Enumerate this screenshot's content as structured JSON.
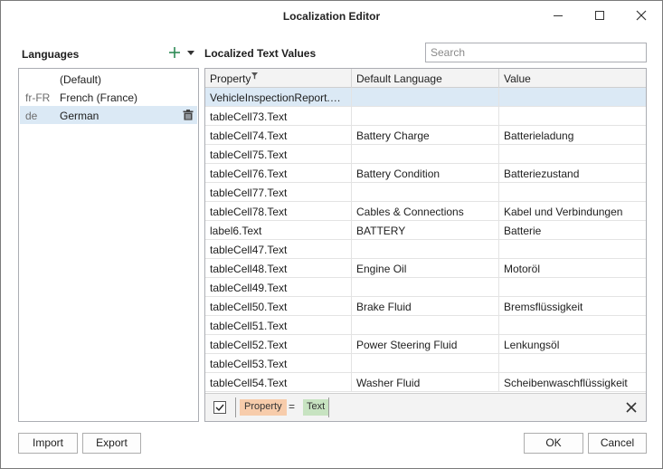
{
  "window": {
    "title": "Localization Editor"
  },
  "languages": {
    "header": "Languages",
    "items": [
      {
        "code": "",
        "name": "(Default)"
      },
      {
        "code": "fr-FR",
        "name": "French (France)"
      },
      {
        "code": "de",
        "name": "German"
      }
    ],
    "selected_index": 2
  },
  "localized": {
    "header": "Localized Text Values",
    "search_placeholder": "Search",
    "columns": [
      "Property",
      "Default Language",
      "Value"
    ],
    "rows": [
      {
        "property": "VehicleInspectionReport.W...",
        "default": "",
        "value": ""
      },
      {
        "property": "tableCell73.Text",
        "default": "",
        "value": ""
      },
      {
        "property": "tableCell74.Text",
        "default": "Battery Charge",
        "value": "Batterieladung"
      },
      {
        "property": "tableCell75.Text",
        "default": "",
        "value": ""
      },
      {
        "property": "tableCell76.Text",
        "default": "Battery Condition",
        "value": "Batteriezustand"
      },
      {
        "property": "tableCell77.Text",
        "default": "",
        "value": ""
      },
      {
        "property": "tableCell78.Text",
        "default": "Cables & Connections",
        "value": "Kabel und Verbindungen"
      },
      {
        "property": "label6.Text",
        "default": "BATTERY",
        "value": "Batterie"
      },
      {
        "property": "tableCell47.Text",
        "default": "",
        "value": ""
      },
      {
        "property": "tableCell48.Text",
        "default": "Engine Oil",
        "value": "Motoröl"
      },
      {
        "property": "tableCell49.Text",
        "default": "",
        "value": ""
      },
      {
        "property": "tableCell50.Text",
        "default": "Brake Fluid",
        "value": "Bremsflüssigkeit"
      },
      {
        "property": "tableCell51.Text",
        "default": "",
        "value": ""
      },
      {
        "property": "tableCell52.Text",
        "default": "Power Steering Fluid",
        "value": "Lenkungsöl"
      },
      {
        "property": "tableCell53.Text",
        "default": "",
        "value": ""
      },
      {
        "property": "tableCell54.Text",
        "default": "Washer Fluid",
        "value": "Scheibenwaschflüssigkeit"
      }
    ],
    "selected_index": 0,
    "filter": {
      "field": "Property",
      "operator": "=",
      "value": "Text",
      "enabled": true
    }
  },
  "buttons": {
    "import": "Import",
    "export": "Export",
    "ok": "OK",
    "cancel": "Cancel"
  },
  "colors": {
    "selection": "#dbe9f5",
    "accent_green": "#2e8b57",
    "filter_field": "#f7ccab",
    "filter_value": "#c7e3c1"
  }
}
